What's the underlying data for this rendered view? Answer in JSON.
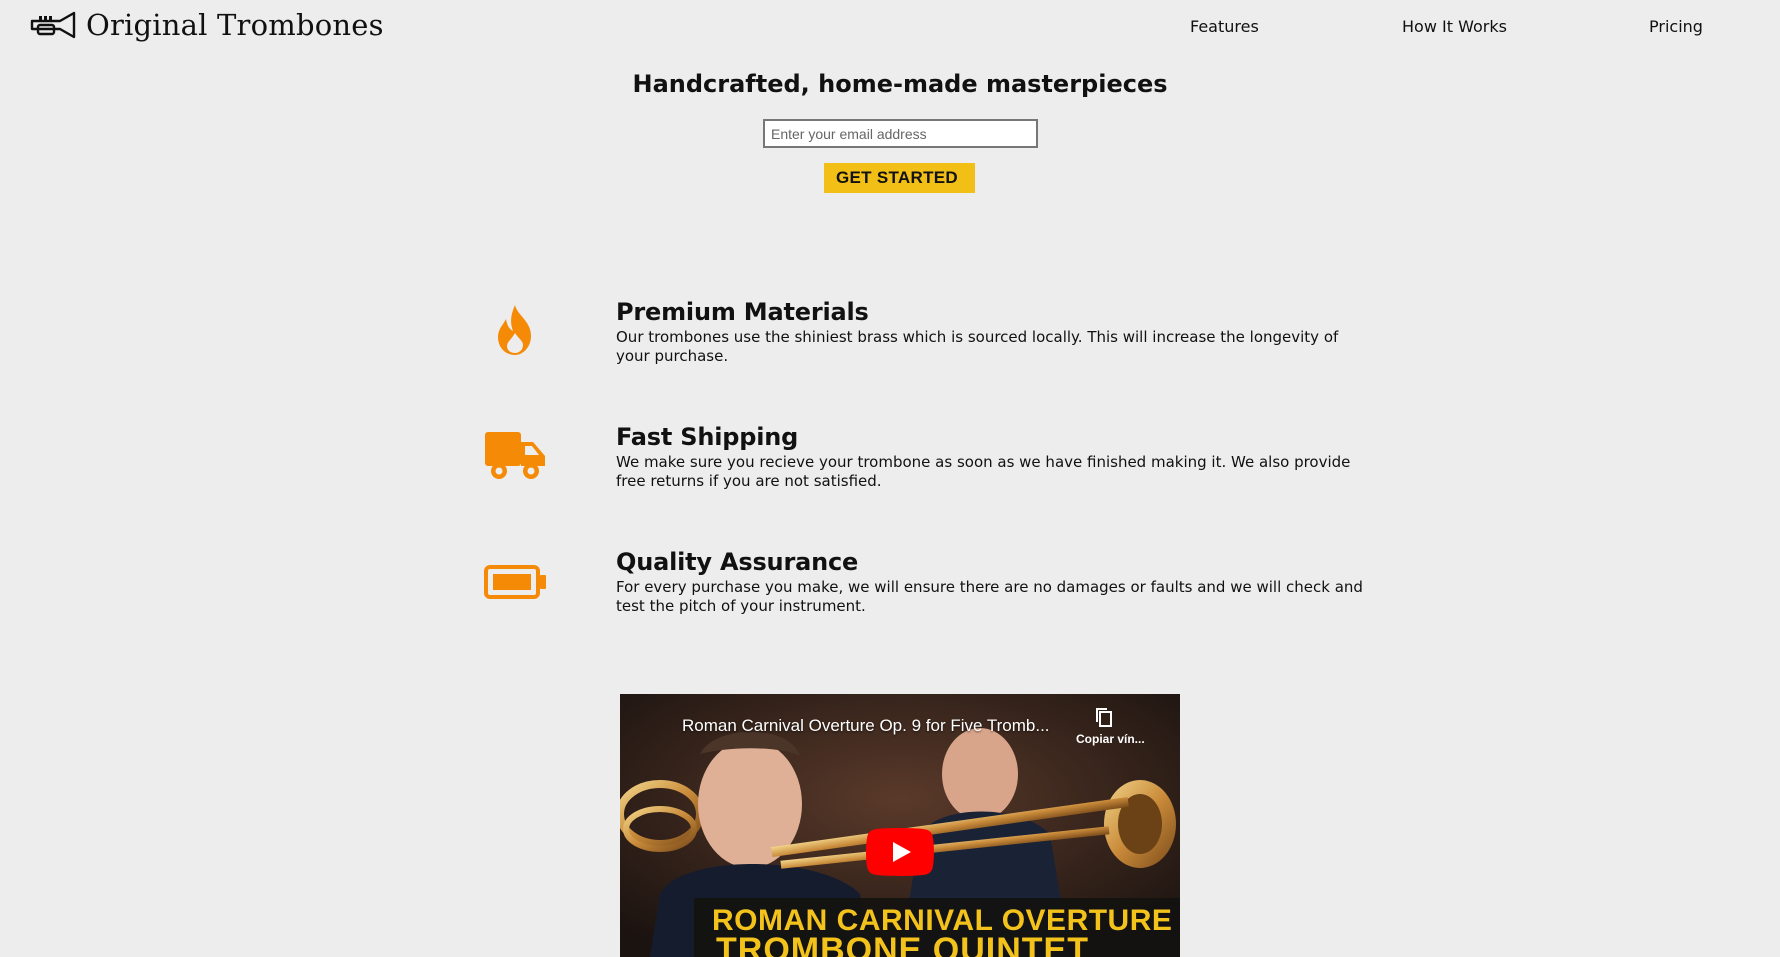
{
  "brand": {
    "name": "Original Trombones",
    "logo_icon": "trumpet-icon"
  },
  "nav": {
    "items": [
      {
        "label": "Features"
      },
      {
        "label": "How It Works"
      },
      {
        "label": "Pricing"
      }
    ]
  },
  "hero": {
    "title": "Handcrafted, home-made masterpieces",
    "email_placeholder": "Enter your email address",
    "email_value": "",
    "cta_label": "GET STARTED"
  },
  "features": [
    {
      "icon": "fire-icon",
      "title": "Premium Materials",
      "description": "Our trombones use the shiniest brass which is sourced locally. This will increase the longevity of your purchase."
    },
    {
      "icon": "truck-icon",
      "title": "Fast Shipping",
      "description": "We make sure you recieve your trombone as soon as we have finished making it. We also provide free returns if you are not satisfied."
    },
    {
      "icon": "battery-icon",
      "title": "Quality Assurance",
      "description": "For every purchase you make, we will ensure there are no damages or faults and we will check and test the pitch of your instrument."
    }
  ],
  "video": {
    "title": "Roman Carnival Overture Op. 9 for Five Tromb...",
    "copy_link_label": "Copiar vín...",
    "banner_line1": "ROMAN CARNIVAL OVERTURE",
    "banner_line2": "TROMBONE QUINTET"
  },
  "colors": {
    "background": "#ededed",
    "accent_orange": "#f58a07",
    "cta_yellow": "#f2bf16",
    "play_red": "#ff0000"
  }
}
